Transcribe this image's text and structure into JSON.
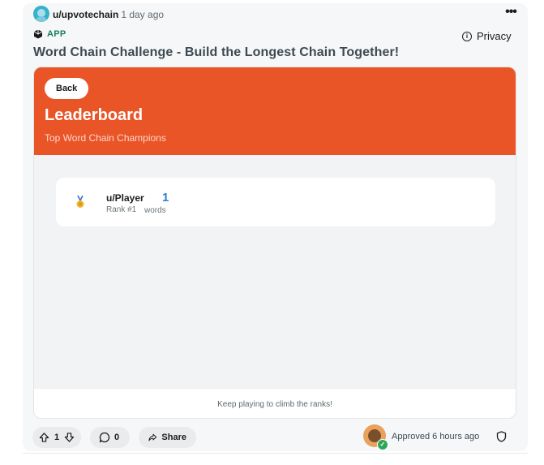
{
  "post": {
    "author": "u/upvotechain",
    "separator_time": "· 1 day ago",
    "more_label": "•••",
    "app_badge": "APP",
    "privacy_label": "Privacy",
    "title": "Word Chain Challenge - Build the Longest Chain Together!"
  },
  "app": {
    "back_label": "Back",
    "heading": "Leaderboard",
    "subheading": "Top Word Chain Champions",
    "entries": [
      {
        "name": "u/Player",
        "rank": "Rank #1",
        "score": "1",
        "unit": "words"
      }
    ],
    "footer": "Keep playing to climb the ranks!"
  },
  "actions": {
    "vote_count": "1",
    "comment_count": "0",
    "share_label": "Share",
    "approval": "Approved 6 hours ago"
  },
  "colors": {
    "banner": "#ea5528",
    "score": "#2f7fd1",
    "app_badge": "#1a7f5a"
  },
  "icons": [
    "snoo-avatar-icon",
    "more-icon",
    "app-icon",
    "info-icon",
    "medal-icon",
    "upvote-icon",
    "downvote-icon",
    "comment-icon",
    "share-icon",
    "moderator-avatar",
    "check-icon",
    "shield-icon"
  ]
}
